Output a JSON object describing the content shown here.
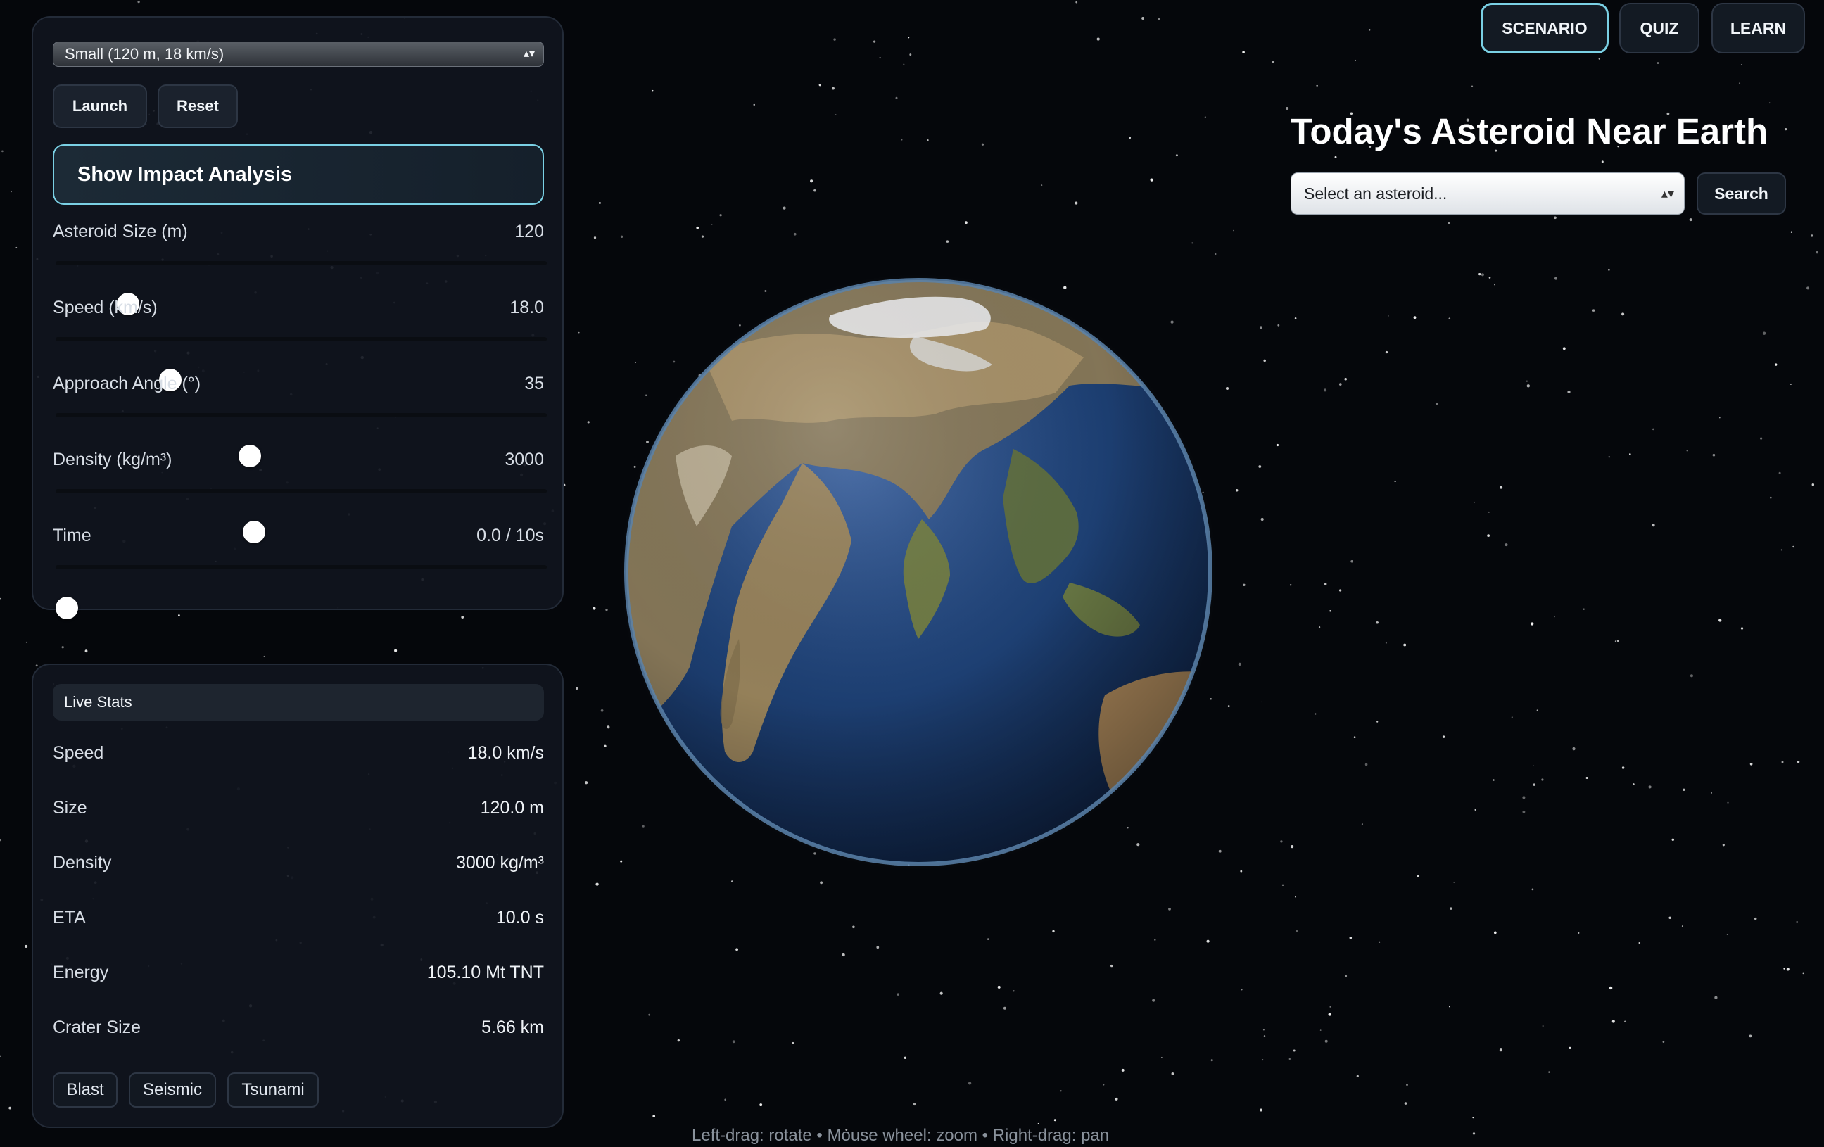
{
  "scenario_controls": {
    "preset": "Small (120 m, 18 km/s)",
    "launch_label": "Launch",
    "reset_label": "Reset",
    "impact_analysis_label": "Show Impact Analysis",
    "sliders": [
      {
        "label": "Asteroid Size (m)",
        "value": "120",
        "fraction": 0.13
      },
      {
        "label": "Speed (km/s)",
        "value": "18.0",
        "fraction": 0.22
      },
      {
        "label": "Approach Angle (°)",
        "value": "35",
        "fraction": 0.39
      },
      {
        "label": "Density (kg/m³)",
        "value": "3000",
        "fraction": 0.4
      },
      {
        "label": "Time",
        "value": "0.0 / 10s",
        "fraction": 0.0
      }
    ]
  },
  "live_stats": {
    "title": "Live Stats",
    "rows": [
      {
        "key": "Speed",
        "value": "18.0 km/s"
      },
      {
        "key": "Size",
        "value": "120.0 m"
      },
      {
        "key": "Density",
        "value": "3000 kg/m³"
      },
      {
        "key": "ETA",
        "value": "10.0 s"
      },
      {
        "key": "Energy",
        "value": "105.10 Mt TNT"
      },
      {
        "key": "Crater Size",
        "value": "5.66 km"
      }
    ],
    "effects": [
      "Blast",
      "Seismic",
      "Tsunami"
    ]
  },
  "nav": {
    "tabs": [
      "SCENARIO",
      "QUIZ",
      "LEARN"
    ],
    "active": "SCENARIO"
  },
  "neo": {
    "title": "Today's Asteroid Near Earth",
    "select_value": "Select an asteroid...",
    "search_label": "Search"
  },
  "hint": "Left-drag: rotate • Mouse wheel: zoom • Right-drag: pan",
  "colors": {
    "background": "#05070b",
    "panel": "#10151e",
    "accent": "#7ad0e4",
    "ocean": "#1d3f72",
    "land": "#8c7a55"
  },
  "icons": {
    "select_arrows": "updown-chevrons",
    "earth": "earth-globe"
  }
}
